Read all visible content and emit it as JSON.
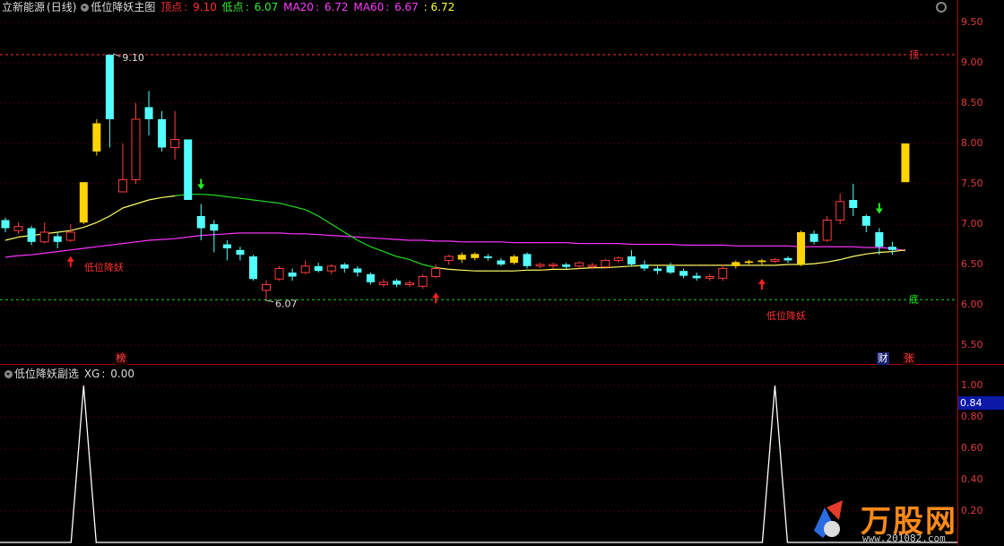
{
  "main_header": {
    "stock": "立新能源",
    "period": "(日线)",
    "indicator": "低位降妖主图",
    "top_label": "顶点",
    "top_value": "9.10",
    "bottom_label": "低点",
    "bottom_value": "6.07",
    "ma20_label": "MA20",
    "ma20_value": "6.72",
    "ma60_label": "MA60",
    "ma60_value": "6.67",
    "extra_value": ": 6.72"
  },
  "sub_header": {
    "indicator": "低位降妖副选",
    "xg_label": "XG",
    "xg_value": "0.00"
  },
  "annotations": {
    "high_price": "9.10",
    "low_price": "6.07",
    "top_tag": "顶",
    "bottom_tag": "底",
    "signal_left": "低位降妖",
    "signal_right": "低位降妖"
  },
  "badges": {
    "bang": "榜",
    "cai": "财",
    "zhang": "张"
  },
  "current_value": "0.84",
  "watermark": {
    "brand": "万股网",
    "url": "www.201082.com"
  },
  "colors": {
    "up": "#ff3c3c",
    "down": "#54ffff",
    "yellow_candle": "#ffd400",
    "ma20_above": "#ffff66",
    "ma20_below": "#22dd22",
    "ma60": "#ff33ff",
    "top_line": "#ff3030",
    "bottom_line": "#22cc22",
    "grid": "#7a0000"
  },
  "chart_data": [
    {
      "type": "candlestick",
      "title": "低位降妖主图",
      "ylim": [
        5.2,
        10.2
      ],
      "y_ticks": [
        "9.50",
        "9.00",
        "8.50",
        "8.00",
        "7.50",
        "7.00",
        "6.50",
        "6.00",
        "5.50"
      ],
      "top_value": 9.1,
      "bottom_value": 6.07,
      "candles": [
        {
          "o": 7.05,
          "c": 6.95,
          "h": 7.08,
          "l": 6.9,
          "k": "dn"
        },
        {
          "o": 6.92,
          "c": 6.97,
          "h": 7.02,
          "l": 6.88,
          "k": "up"
        },
        {
          "o": 6.95,
          "c": 6.78,
          "h": 6.98,
          "l": 6.74,
          "k": "dn"
        },
        {
          "o": 6.78,
          "c": 6.9,
          "h": 7.02,
          "l": 6.76,
          "k": "up"
        },
        {
          "o": 6.85,
          "c": 6.78,
          "h": 6.9,
          "l": 6.7,
          "k": "dn"
        },
        {
          "o": 6.8,
          "c": 6.9,
          "h": 7.0,
          "l": 6.78,
          "k": "up"
        },
        {
          "o": 7.02,
          "c": 7.52,
          "h": 7.52,
          "l": 7.0,
          "k": "yellow"
        },
        {
          "o": 7.9,
          "c": 8.25,
          "h": 8.3,
          "l": 7.85,
          "k": "yellow"
        },
        {
          "o": 8.3,
          "c": 9.1,
          "h": 9.1,
          "l": 7.95,
          "k": "dn"
        },
        {
          "o": 7.4,
          "c": 7.55,
          "h": 8.0,
          "l": 7.4,
          "k": "up"
        },
        {
          "o": 7.55,
          "c": 8.3,
          "h": 8.5,
          "l": 7.5,
          "k": "up"
        },
        {
          "o": 8.45,
          "c": 8.3,
          "h": 8.65,
          "l": 8.1,
          "k": "dn"
        },
        {
          "o": 8.3,
          "c": 7.95,
          "h": 8.4,
          "l": 7.9,
          "k": "dn"
        },
        {
          "o": 7.95,
          "c": 8.05,
          "h": 8.4,
          "l": 7.8,
          "k": "up"
        },
        {
          "o": 8.05,
          "c": 7.3,
          "h": 8.05,
          "l": 7.3,
          "k": "dn"
        },
        {
          "o": 7.1,
          "c": 6.95,
          "h": 7.25,
          "l": 6.8,
          "k": "dn"
        },
        {
          "o": 7.0,
          "c": 6.92,
          "h": 7.05,
          "l": 6.65,
          "k": "dn"
        },
        {
          "o": 6.75,
          "c": 6.7,
          "h": 6.8,
          "l": 6.55,
          "k": "dn"
        },
        {
          "o": 6.68,
          "c": 6.62,
          "h": 6.72,
          "l": 6.55,
          "k": "dn"
        },
        {
          "o": 6.6,
          "c": 6.32,
          "h": 6.62,
          "l": 6.3,
          "k": "dn"
        },
        {
          "o": 6.18,
          "c": 6.25,
          "h": 6.3,
          "l": 6.07,
          "k": "up"
        },
        {
          "o": 6.32,
          "c": 6.45,
          "h": 6.48,
          "l": 6.3,
          "k": "up"
        },
        {
          "o": 6.4,
          "c": 6.35,
          "h": 6.45,
          "l": 6.3,
          "k": "dn"
        },
        {
          "o": 6.4,
          "c": 6.48,
          "h": 6.55,
          "l": 6.38,
          "k": "up"
        },
        {
          "o": 6.48,
          "c": 6.42,
          "h": 6.52,
          "l": 6.4,
          "k": "dn"
        },
        {
          "o": 6.42,
          "c": 6.48,
          "h": 6.5,
          "l": 6.38,
          "k": "up"
        },
        {
          "o": 6.5,
          "c": 6.45,
          "h": 6.52,
          "l": 6.4,
          "k": "dn"
        },
        {
          "o": 6.45,
          "c": 6.4,
          "h": 6.48,
          "l": 6.35,
          "k": "dn"
        },
        {
          "o": 6.38,
          "c": 6.28,
          "h": 6.4,
          "l": 6.25,
          "k": "dn"
        },
        {
          "o": 6.25,
          "c": 6.28,
          "h": 6.32,
          "l": 6.22,
          "k": "up"
        },
        {
          "o": 6.3,
          "c": 6.25,
          "h": 6.32,
          "l": 6.22,
          "k": "dn"
        },
        {
          "o": 6.25,
          "c": 6.27,
          "h": 6.3,
          "l": 6.22,
          "k": "up"
        },
        {
          "o": 6.23,
          "c": 6.35,
          "h": 6.38,
          "l": 6.2,
          "k": "up"
        },
        {
          "o": 6.35,
          "c": 6.45,
          "h": 6.5,
          "l": 6.33,
          "k": "up"
        },
        {
          "o": 6.55,
          "c": 6.6,
          "h": 6.62,
          "l": 6.5,
          "k": "up"
        },
        {
          "o": 6.56,
          "c": 6.62,
          "h": 6.65,
          "l": 6.52,
          "k": "yellow"
        },
        {
          "o": 6.58,
          "c": 6.63,
          "h": 6.65,
          "l": 6.55,
          "k": "yellow"
        },
        {
          "o": 6.6,
          "c": 6.58,
          "h": 6.63,
          "l": 6.55,
          "k": "dn"
        },
        {
          "o": 6.55,
          "c": 6.5,
          "h": 6.58,
          "l": 6.48,
          "k": "dn"
        },
        {
          "o": 6.52,
          "c": 6.6,
          "h": 6.62,
          "l": 6.5,
          "k": "yellow"
        },
        {
          "o": 6.63,
          "c": 6.48,
          "h": 6.65,
          "l": 6.45,
          "k": "dn"
        },
        {
          "o": 6.48,
          "c": 6.5,
          "h": 6.52,
          "l": 6.45,
          "k": "up"
        },
        {
          "o": 6.5,
          "c": 6.49,
          "h": 6.52,
          "l": 6.45,
          "k": "up"
        },
        {
          "o": 6.5,
          "c": 6.47,
          "h": 6.52,
          "l": 6.44,
          "k": "dn"
        },
        {
          "o": 6.48,
          "c": 6.52,
          "h": 6.54,
          "l": 6.45,
          "k": "up"
        },
        {
          "o": 6.48,
          "c": 6.49,
          "h": 6.52,
          "l": 6.44,
          "k": "up"
        },
        {
          "o": 6.47,
          "c": 6.55,
          "h": 6.57,
          "l": 6.45,
          "k": "up"
        },
        {
          "o": 6.55,
          "c": 6.58,
          "h": 6.6,
          "l": 6.52,
          "k": "up"
        },
        {
          "o": 6.6,
          "c": 6.5,
          "h": 6.68,
          "l": 6.48,
          "k": "dn"
        },
        {
          "o": 6.5,
          "c": 6.45,
          "h": 6.55,
          "l": 6.42,
          "k": "dn"
        },
        {
          "o": 6.45,
          "c": 6.42,
          "h": 6.48,
          "l": 6.38,
          "k": "dn"
        },
        {
          "o": 6.48,
          "c": 6.4,
          "h": 6.52,
          "l": 6.38,
          "k": "dn"
        },
        {
          "o": 6.42,
          "c": 6.36,
          "h": 6.45,
          "l": 6.33,
          "k": "dn"
        },
        {
          "o": 6.36,
          "c": 6.33,
          "h": 6.4,
          "l": 6.3,
          "k": "dn"
        },
        {
          "o": 6.33,
          "c": 6.35,
          "h": 6.38,
          "l": 6.3,
          "k": "up"
        },
        {
          "o": 6.33,
          "c": 6.45,
          "h": 6.5,
          "l": 6.3,
          "k": "up"
        },
        {
          "o": 6.48,
          "c": 6.53,
          "h": 6.55,
          "l": 6.45,
          "k": "yellow"
        },
        {
          "o": 6.52,
          "c": 6.54,
          "h": 6.56,
          "l": 6.5,
          "k": "yellow"
        },
        {
          "o": 6.53,
          "c": 6.55,
          "h": 6.57,
          "l": 6.5,
          "k": "yellow"
        },
        {
          "o": 6.54,
          "c": 6.56,
          "h": 6.58,
          "l": 6.52,
          "k": "up"
        },
        {
          "o": 6.55,
          "c": 6.58,
          "h": 6.6,
          "l": 6.52,
          "k": "dn"
        },
        {
          "o": 6.5,
          "c": 6.9,
          "h": 6.92,
          "l": 6.48,
          "k": "yellow"
        },
        {
          "o": 6.88,
          "c": 6.78,
          "h": 6.92,
          "l": 6.75,
          "k": "dn"
        },
        {
          "o": 6.8,
          "c": 7.05,
          "h": 7.1,
          "l": 6.78,
          "k": "up"
        },
        {
          "o": 7.05,
          "c": 7.28,
          "h": 7.38,
          "l": 7.0,
          "k": "up"
        },
        {
          "o": 7.3,
          "c": 7.2,
          "h": 7.5,
          "l": 7.1,
          "k": "dn"
        },
        {
          "o": 7.1,
          "c": 6.98,
          "h": 7.12,
          "l": 6.9,
          "k": "dn"
        },
        {
          "o": 6.9,
          "c": 6.72,
          "h": 6.95,
          "l": 6.62,
          "k": "dn"
        },
        {
          "o": 6.72,
          "c": 6.68,
          "h": 6.78,
          "l": 6.62,
          "k": "dn"
        },
        {
          "o": 7.52,
          "c": 8.0,
          "h": 8.0,
          "l": 7.52,
          "k": "yellow"
        }
      ],
      "ma20": [
        6.8,
        6.84,
        6.86,
        6.88,
        6.9,
        6.92,
        6.96,
        7.02,
        7.1,
        7.2,
        7.25,
        7.3,
        7.33,
        7.35,
        7.37,
        7.37,
        7.36,
        7.34,
        7.32,
        7.3,
        7.28,
        7.26,
        7.22,
        7.18,
        7.1,
        7.0,
        6.9,
        6.8,
        6.72,
        6.66,
        6.6,
        6.56,
        6.5,
        6.46,
        6.44,
        6.43,
        6.42,
        6.42,
        6.42,
        6.42,
        6.43,
        6.43,
        6.44,
        6.44,
        6.45,
        6.46,
        6.46,
        6.47,
        6.48,
        6.49,
        6.49,
        6.49,
        6.49,
        6.49,
        6.49,
        6.49,
        6.49,
        6.49,
        6.49,
        6.49,
        6.5,
        6.5,
        6.51,
        6.53,
        6.56,
        6.6,
        6.63,
        6.65,
        6.66,
        6.68
      ],
      "ma60": [
        6.59,
        6.61,
        6.62,
        6.64,
        6.66,
        6.68,
        6.7,
        6.72,
        6.74,
        6.76,
        6.78,
        6.8,
        6.81,
        6.82,
        6.84,
        6.86,
        6.87,
        6.88,
        6.89,
        6.89,
        6.89,
        6.89,
        6.88,
        6.88,
        6.87,
        6.86,
        6.85,
        6.84,
        6.83,
        6.82,
        6.81,
        6.8,
        6.8,
        6.79,
        6.79,
        6.78,
        6.78,
        6.78,
        6.78,
        6.77,
        6.77,
        6.77,
        6.77,
        6.77,
        6.76,
        6.76,
        6.76,
        6.76,
        6.75,
        6.75,
        6.75,
        6.75,
        6.74,
        6.74,
        6.74,
        6.74,
        6.73,
        6.73,
        6.73,
        6.73,
        6.73,
        6.72,
        6.72,
        6.72,
        6.72,
        6.72,
        6.71,
        6.71,
        6.7,
        6.67
      ],
      "buy_signal_candles": [
        5,
        33,
        58
      ],
      "sell_signal_candles": [
        15,
        67
      ]
    },
    {
      "type": "line",
      "title": "低位降妖副选",
      "series_name": "XG",
      "ylim": [
        0,
        1.1
      ],
      "y_ticks": [
        "1.00",
        "0.80",
        "0.60",
        "0.40",
        "0.20"
      ],
      "spikes_at_candle": [
        6,
        59
      ],
      "current": 0.84
    }
  ]
}
